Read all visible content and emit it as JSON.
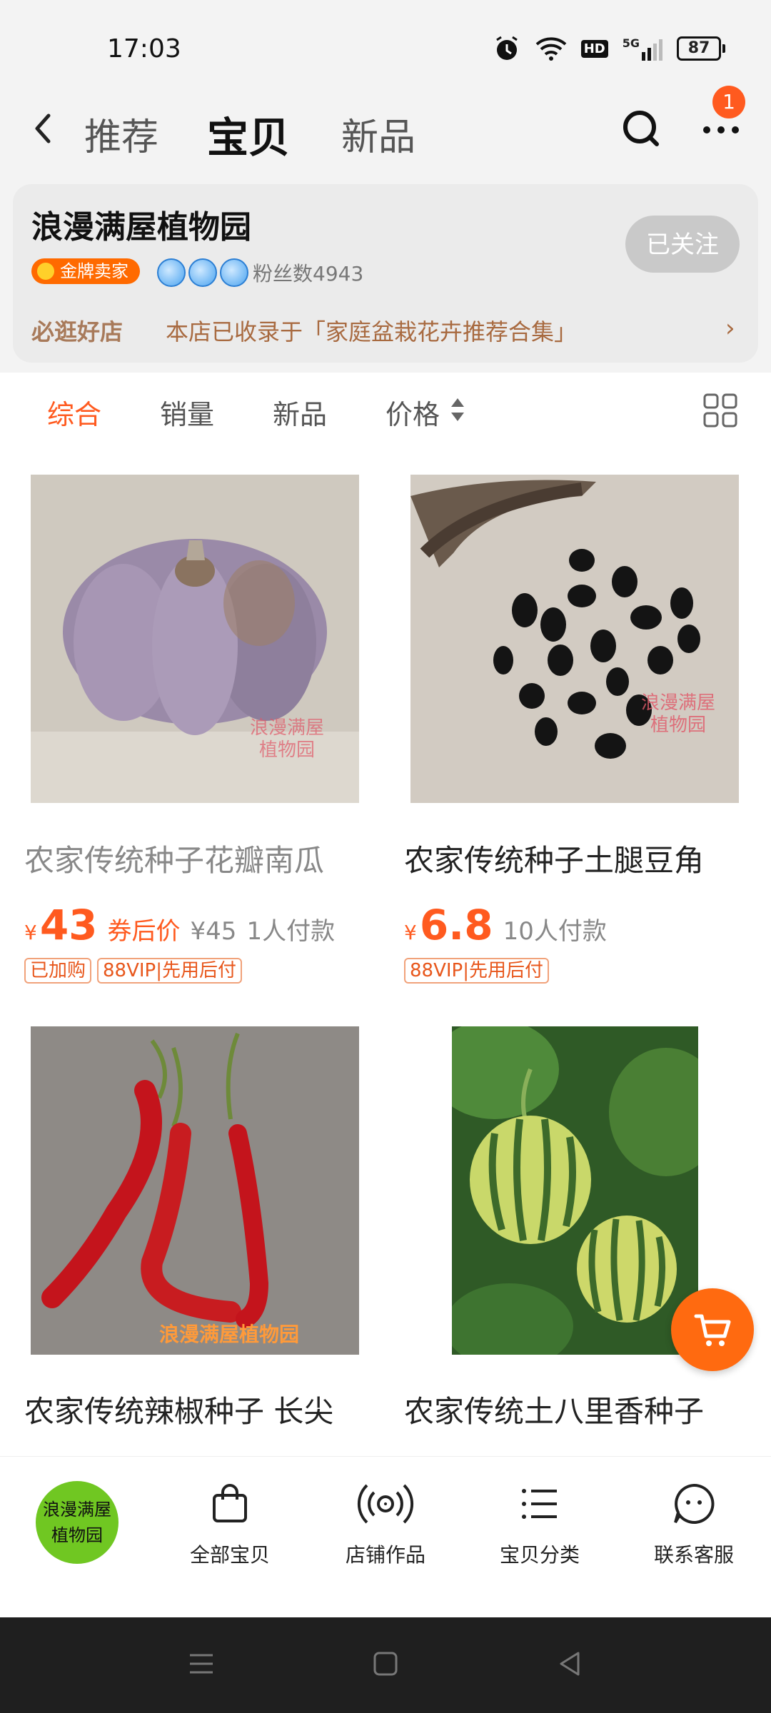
{
  "status_bar": {
    "time": "17:03",
    "battery": "87",
    "network": "5G",
    "hd": "HD"
  },
  "nav": {
    "tabs": [
      "推荐",
      "宝贝",
      "新品"
    ],
    "active_tab": "宝贝",
    "notification_count": "1"
  },
  "store": {
    "name": "浪漫满屋植物园",
    "follow_label": "已关注",
    "gold_badge": "金牌卖家",
    "fans": "粉丝数4943",
    "must_visit": "必逛好店",
    "included_text": "本店已收录于「家庭盆栽花卉推荐合集」"
  },
  "sort": {
    "options": [
      "综合",
      "销量",
      "新品",
      "价格"
    ],
    "active": "综合"
  },
  "products": [
    {
      "title": "农家传统种子花瓣南瓜",
      "yen": "¥",
      "price": "43",
      "coupon": "券后价",
      "original": "¥45",
      "sold": "1人付款",
      "tags": [
        "已加购",
        "88VIP|先用后付"
      ],
      "watermark": "浪漫满屋\n植物园"
    },
    {
      "title": "农家传统种子土腿豆角",
      "yen": "¥",
      "price": "6.8",
      "sold": "10人付款",
      "tags": [
        "88VIP|先用后付"
      ],
      "watermark": "浪漫满屋\n植物园"
    },
    {
      "title": "农家传统辣椒种子 长尖",
      "watermark": "浪漫满屋植物园"
    },
    {
      "title": "农家传统土八里香种子"
    }
  ],
  "bottom_bar": {
    "logo_text": "浪漫满屋\n植物园",
    "items": [
      "全部宝贝",
      "店铺作品",
      "宝贝分类",
      "联系客服"
    ]
  },
  "colors": {
    "accent": "#ff5a1f",
    "gold_badge": "#ff6a00",
    "logo_green": "#70c722"
  }
}
